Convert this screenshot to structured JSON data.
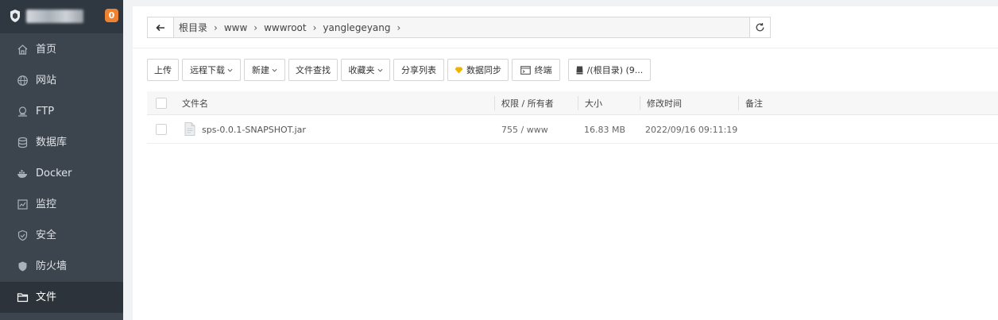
{
  "sidebar": {
    "badge_count": "0",
    "items": [
      {
        "label": "首页",
        "icon": "home-icon"
      },
      {
        "label": "网站",
        "icon": "globe-icon"
      },
      {
        "label": "FTP",
        "icon": "ftp-icon"
      },
      {
        "label": "数据库",
        "icon": "database-icon"
      },
      {
        "label": "Docker",
        "icon": "docker-icon"
      },
      {
        "label": "监控",
        "icon": "monitor-icon"
      },
      {
        "label": "安全",
        "icon": "shield-icon"
      },
      {
        "label": "防火墙",
        "icon": "firewall-icon"
      },
      {
        "label": "文件",
        "icon": "folder-icon",
        "active": true
      }
    ]
  },
  "breadcrumb": [
    "根目录",
    "www",
    "wwwroot",
    "yanglegeyang"
  ],
  "toolbar": {
    "upload": "上传",
    "remote_download": "远程下载",
    "new": "新建",
    "file_search": "文件查找",
    "favorites": "收藏夹",
    "share_list": "分享列表",
    "data_sync": "数据同步",
    "terminal": "终端",
    "disk": "/(根目录) (9..."
  },
  "table": {
    "headers": {
      "name": "文件名",
      "perm": "权限 / 所有者",
      "size": "大小",
      "mtime": "修改时间",
      "note": "备注"
    },
    "rows": [
      {
        "name": "sps-0.0.1-SNAPSHOT.jar",
        "perm": "755 / www",
        "size": "16.83 MB",
        "mtime": "2022/09/16 09:11:19",
        "note": ""
      }
    ]
  },
  "colors": {
    "sidebar_bg": "#3c444d",
    "sidebar_active_bg": "#2c333b",
    "badge": "#f0812e",
    "sync_icon": "#f0b400"
  }
}
